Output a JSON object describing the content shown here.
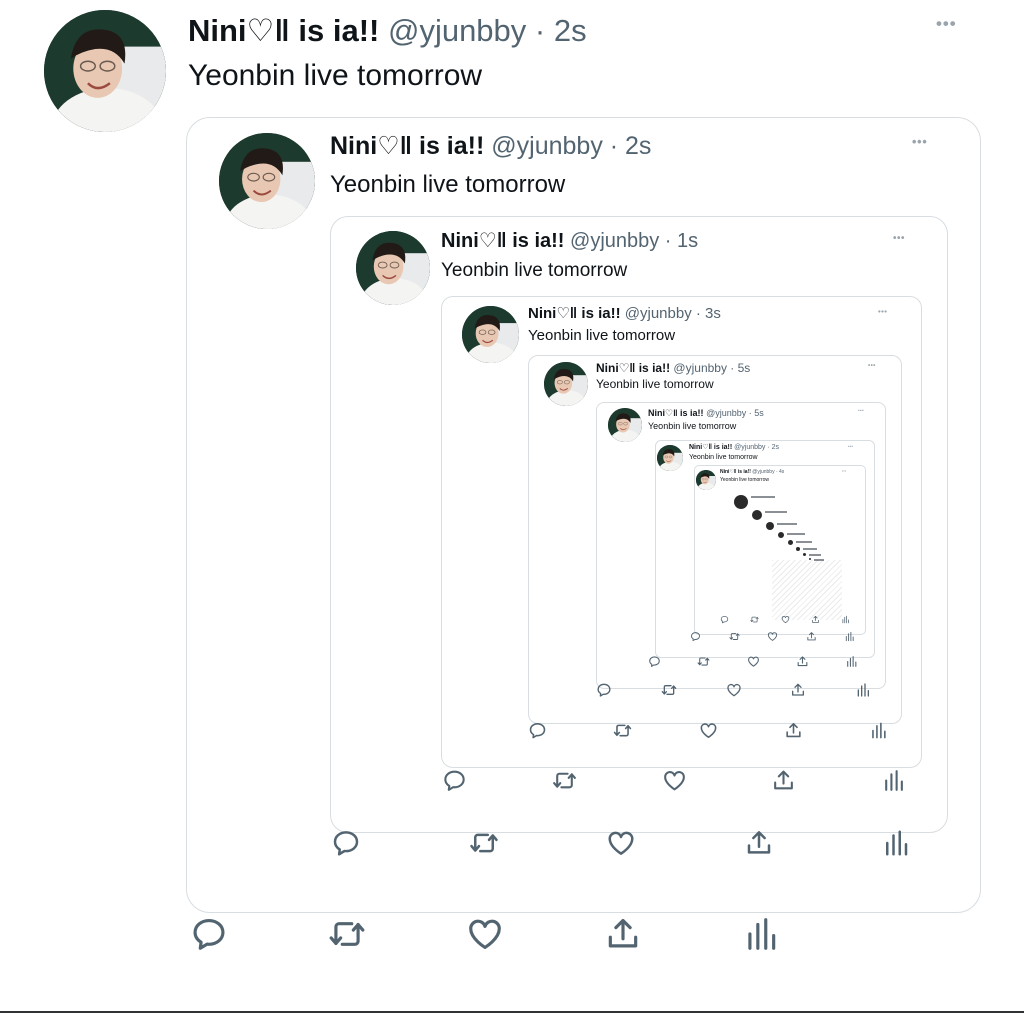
{
  "tweet": {
    "display_name": "Nini♡‖ is ia!!",
    "text": "Yeonbin live tomorrow"
  },
  "levels": [
    {
      "handle_time": "@yjunbby · 2s"
    },
    {
      "handle_time": "@yjunbby · 2s"
    },
    {
      "handle_time": "@yjunbby · 1s"
    },
    {
      "handle_time": "@yjunbby · 3s"
    },
    {
      "handle_time": "@yjunbby · 5s"
    },
    {
      "handle_time": "@yjunbby · 5s"
    },
    {
      "handle_time": "@yjunbby · 2s"
    },
    {
      "handle_time": "@yjunbby · 4s"
    }
  ],
  "icons": {
    "more": "more-icon",
    "reply": "reply-icon",
    "retweet": "retweet-icon",
    "like": "like-icon",
    "share": "share-icon",
    "analytics": "analytics-icon"
  },
  "colors": {
    "icon": "#536471",
    "border": "#d8dde1",
    "text": "#0f1419",
    "meta": "#536471"
  }
}
